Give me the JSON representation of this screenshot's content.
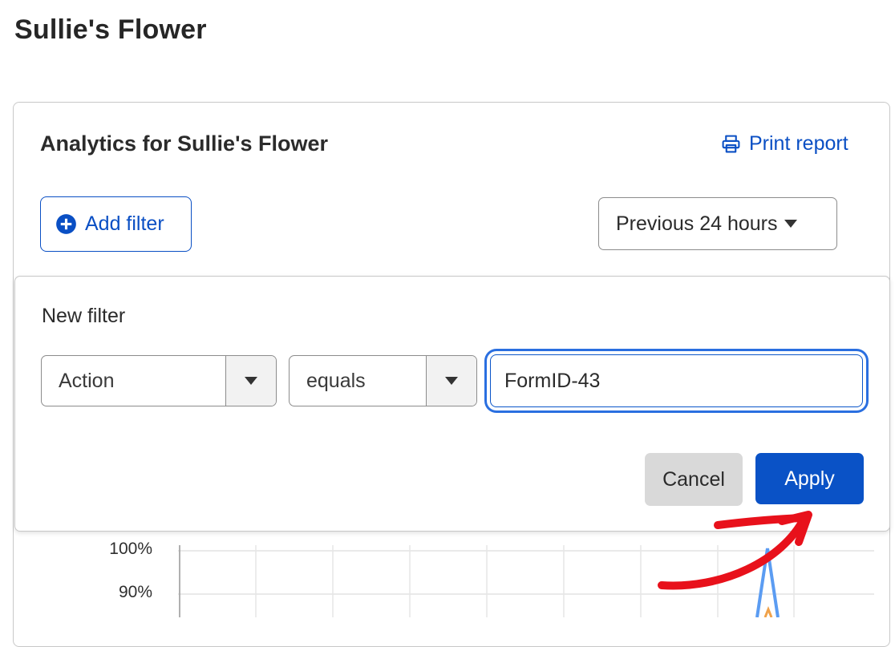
{
  "page": {
    "title": "Sullie's Flower"
  },
  "card": {
    "title": "Analytics for Sullie's Flower",
    "print_label": "Print report",
    "add_filter_label": "Add filter",
    "time_range": "Previous 24 hours"
  },
  "filter": {
    "heading": "New filter",
    "field": "Action",
    "operator": "equals",
    "value": "FormID-43",
    "cancel_label": "Cancel",
    "apply_label": "Apply"
  },
  "chart": {
    "y_ticks": [
      "100%",
      "90%"
    ],
    "line_color": "#5b9cf2",
    "secondary_color": "#f0a24a"
  },
  "colors": {
    "accent": "#0a52c6",
    "annotation": "#e8111b"
  },
  "icons": {
    "print": "printer-icon",
    "add": "plus-circle-icon",
    "dropdown": "caret-down-icon"
  }
}
